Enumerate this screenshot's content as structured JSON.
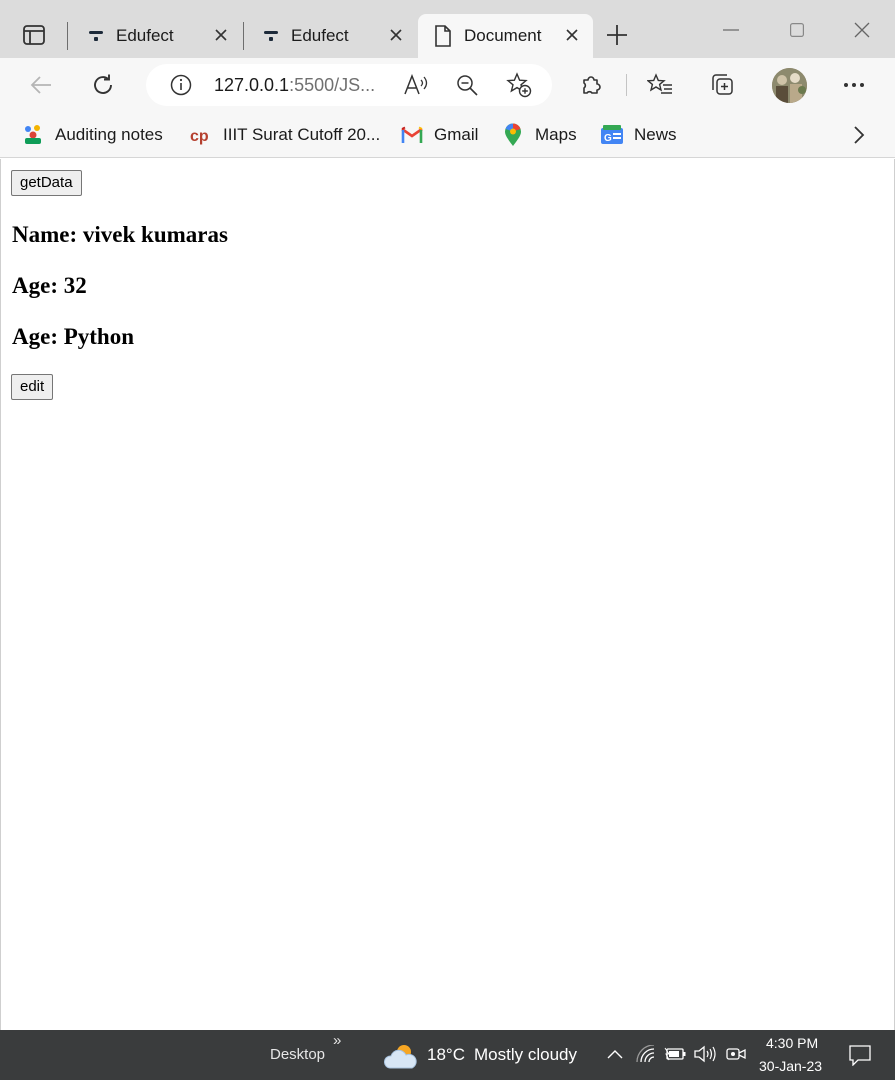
{
  "browser": {
    "tabs": [
      {
        "label": "Edufect",
        "active": false
      },
      {
        "label": "Edufect",
        "active": false
      },
      {
        "label": "Document",
        "active": true
      }
    ],
    "address": {
      "host": "127.0.0.1",
      "rest": ":5500/JS..."
    }
  },
  "favorites": [
    {
      "label": "Auditing notes",
      "icon": "auditing-notes-icon"
    },
    {
      "label": "IIIT Surat Cutoff 20...",
      "icon": "cp-icon"
    },
    {
      "label": "Gmail",
      "icon": "gmail-icon"
    },
    {
      "label": "Maps",
      "icon": "maps-pin-icon"
    },
    {
      "label": "News",
      "icon": "news-icon"
    }
  ],
  "page": {
    "get_button": "getData",
    "name_line": "Name: vivek kumaras",
    "age_line": "Age: 32",
    "skill_line": "Age: Python",
    "edit_button": "edit"
  },
  "taskbar": {
    "desktop_label": "Desktop",
    "desktop_chevron": "»",
    "temperature": "18°C",
    "weather": "Mostly cloudy",
    "time": "4:30 PM",
    "date": "30-Jan-23"
  },
  "colors": {
    "tabstrip": "#dcdcdc",
    "toolbar": "#f7f7f7",
    "taskbar": "#3a3c3d",
    "gmail_red": "#ea4335",
    "maps_green": "#34a853",
    "news_blue": "#4285f4"
  }
}
